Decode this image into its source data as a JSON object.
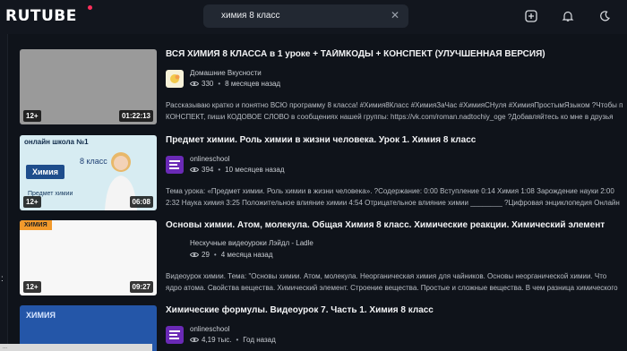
{
  "header": {
    "logo": "RUTUBE",
    "search_value": "химия 8 класс",
    "icons": [
      "upload-icon",
      "bell-icon",
      "moon-icon"
    ]
  },
  "results": [
    {
      "title": "ВСЯ ХИМИЯ 8 КЛАССА в 1 уроке + ТАЙМКОДЫ + КОНСПЕКТ (УЛУЧШЕННАЯ ВЕРСИЯ)",
      "channel": "Домашние Вкусности",
      "views": "330",
      "date": "8 месяцев назад",
      "age": "12+",
      "duration": "01:22:13",
      "desc1": "Рассказываю кратко и понятно ВСЮ программу 8 класса! #Химия8Класс #ХимияЗаЧас #ХимияСНуля #ХимияПростымЯзыком ?Чтобы п",
      "desc2": "КОНСПЕКТ, пиши КОДОВОЕ СЛОВО в сообщениях нашей группы: https://vk.com/roman.nadtochiy_oge ?Добавляйтесь ко мне в друзья"
    },
    {
      "title": "Предмет химии. Роль химии в жизни человека. Урок 1. Химия 8 класс",
      "channel": "onlineschool",
      "views": "394",
      "date": "10 месяцев назад",
      "age": "12+",
      "duration": "06:08",
      "thumb_brand": "онлайн школа №1",
      "thumb_grade": "8 класс",
      "thumb_subject": "Химия",
      "thumb_topic": "Предмет химии",
      "desc1": "Тема урока: «Предмет химии. Роль химии в жизни человека». ?Содержание: 0:00 Вступление 0:14 Химия 1:08 Зарождение науки 2:00",
      "desc2": "2:32 Наука химия 3:25 Положительное влияние химии 4:54 Отрицательное влияние химии ________ ?Цифровая энциклопедия Онлайн"
    },
    {
      "title": "Основы химии. Атом, молекула. Общая Химия 8 класс. Химические реакции. Химический элемент",
      "channel": "Нескучные видеоуроки Лэйдл - Ladle",
      "views": "29",
      "date": "4 месяца назад",
      "age": "12+",
      "duration": "09:27",
      "thumb_tag": "ХИМИЯ",
      "desc1": "Видеоурок химии. Тема: \"Основы химии. Атом, молекула. Неорганическая химия для чайников. Основы неорганической химии. Что",
      "desc2": "ядро атома. Свойства вещества. Химический элемент. Строение вещества. Простые и сложные вещества. В чем разница химического"
    },
    {
      "title": "Химические формулы. Видеоурок 7. Часть 1. Химия 8 класс",
      "channel": "onlineschool",
      "views": "4,19 тыс.",
      "date": "Год назад",
      "thumb_tag": "ХИМИЯ"
    }
  ],
  "status_strip": "..."
}
